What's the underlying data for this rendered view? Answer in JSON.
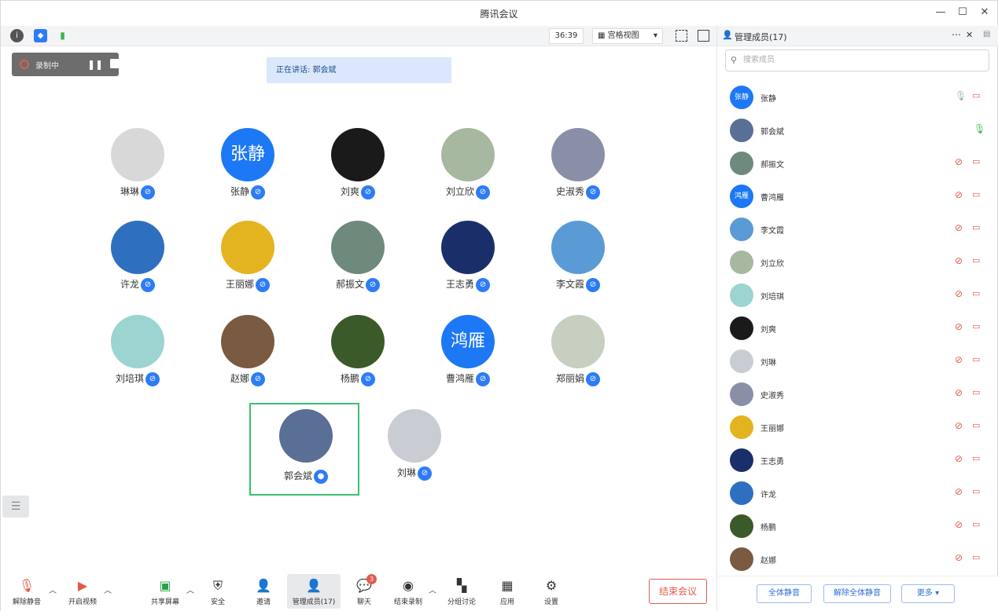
{
  "window": {
    "title": "腾讯会议"
  },
  "toolbar": {
    "timer": "36:39",
    "view_label": "宫格视图"
  },
  "recording": {
    "status": "录制中"
  },
  "speaking": {
    "text": "正在讲话: 郭会斌"
  },
  "participants": [
    {
      "name": "琳琳",
      "avatar_text": "",
      "color": "#d8d8d8"
    },
    {
      "name": "张静",
      "avatar_text": "张静",
      "color": "#1d78f5"
    },
    {
      "name": "刘爽",
      "avatar_text": "",
      "color": "#1a1a1a"
    },
    {
      "name": "刘立欣",
      "avatar_text": "",
      "color": "#a6b8a0"
    },
    {
      "name": "史淑秀",
      "avatar_text": "",
      "color": "#8a8fa8"
    },
    {
      "name": "许龙",
      "avatar_text": "",
      "color": "#2f6fc0"
    },
    {
      "name": "王丽娜",
      "avatar_text": "",
      "color": "#e4b420"
    },
    {
      "name": "郝振文",
      "avatar_text": "",
      "color": "#6e8a7c"
    },
    {
      "name": "王志勇",
      "avatar_text": "",
      "color": "#1a2f6a"
    },
    {
      "name": "李文霞",
      "avatar_text": "",
      "color": "#5a9bd6"
    },
    {
      "name": "刘培琪",
      "avatar_text": "",
      "color": "#9bd4d0"
    },
    {
      "name": "赵娜",
      "avatar_text": "",
      "color": "#7a5a40"
    },
    {
      "name": "杨鹏",
      "avatar_text": "",
      "color": "#3a5a2a"
    },
    {
      "name": "曹鸿雁",
      "avatar_text": "鸿雁",
      "color": "#1d78f5"
    },
    {
      "name": "郑丽娟",
      "avatar_text": "",
      "color": "#c6cfc0"
    },
    {
      "name": "郭会斌",
      "avatar_text": "",
      "color": "#5a6f96"
    },
    {
      "name": "刘琳",
      "avatar_text": "",
      "color": "#c9ccd2"
    }
  ],
  "bottombar": {
    "unmute": "解除静音",
    "video": "开启视频",
    "share": "共享屏幕",
    "security": "安全",
    "invite": "邀请",
    "members": "管理成员(17)",
    "chat": "聊天",
    "chat_badge": "3",
    "stop_record": "结束录制",
    "breakout": "分组讨论",
    "apps": "应用",
    "settings": "设置",
    "end": "结束会议"
  },
  "panel": {
    "title": "管理成员(17)",
    "search_placeholder": "搜索成员",
    "members": [
      {
        "name": "张静",
        "avatar_text": "张静",
        "color": "#1d78f5",
        "mic": "off-gray",
        "cam": "off"
      },
      {
        "name": "郭会斌",
        "avatar_text": "",
        "color": "#5a6f96",
        "mic": "on",
        "cam": "none"
      },
      {
        "name": "郝振文",
        "avatar_text": "",
        "color": "#6e8a7c",
        "mic": "muted",
        "cam": "off"
      },
      {
        "name": "曹鸿雁",
        "avatar_text": "鸿雁",
        "color": "#1d78f5",
        "mic": "muted",
        "cam": "off"
      },
      {
        "name": "李文霞",
        "avatar_text": "",
        "color": "#5a9bd6",
        "mic": "muted",
        "cam": "off"
      },
      {
        "name": "刘立欣",
        "avatar_text": "",
        "color": "#a6b8a0",
        "mic": "muted",
        "cam": "off"
      },
      {
        "name": "刘培琪",
        "avatar_text": "",
        "color": "#9bd4d0",
        "mic": "muted",
        "cam": "off"
      },
      {
        "name": "刘爽",
        "avatar_text": "",
        "color": "#1a1a1a",
        "mic": "muted",
        "cam": "off"
      },
      {
        "name": "刘琳",
        "avatar_text": "",
        "color": "#c9ccd2",
        "mic": "muted",
        "cam": "off"
      },
      {
        "name": "史淑秀",
        "avatar_text": "",
        "color": "#8a8fa8",
        "mic": "muted",
        "cam": "off"
      },
      {
        "name": "王丽娜",
        "avatar_text": "",
        "color": "#e4b420",
        "mic": "muted",
        "cam": "off"
      },
      {
        "name": "王志勇",
        "avatar_text": "",
        "color": "#1a2f6a",
        "mic": "muted",
        "cam": "off"
      },
      {
        "name": "许龙",
        "avatar_text": "",
        "color": "#2f6fc0",
        "mic": "muted",
        "cam": "off"
      },
      {
        "name": "杨鹏",
        "avatar_text": "",
        "color": "#3a5a2a",
        "mic": "muted",
        "cam": "off"
      },
      {
        "name": "赵娜",
        "avatar_text": "",
        "color": "#7a5a40",
        "mic": "muted",
        "cam": "off"
      }
    ],
    "mute_all": "全体静音",
    "unmute_all": "解除全体静音",
    "more": "更多"
  },
  "colors": {
    "accent": "#2d7cf6",
    "danger": "#e25a4d",
    "active_border": "#38c172"
  }
}
